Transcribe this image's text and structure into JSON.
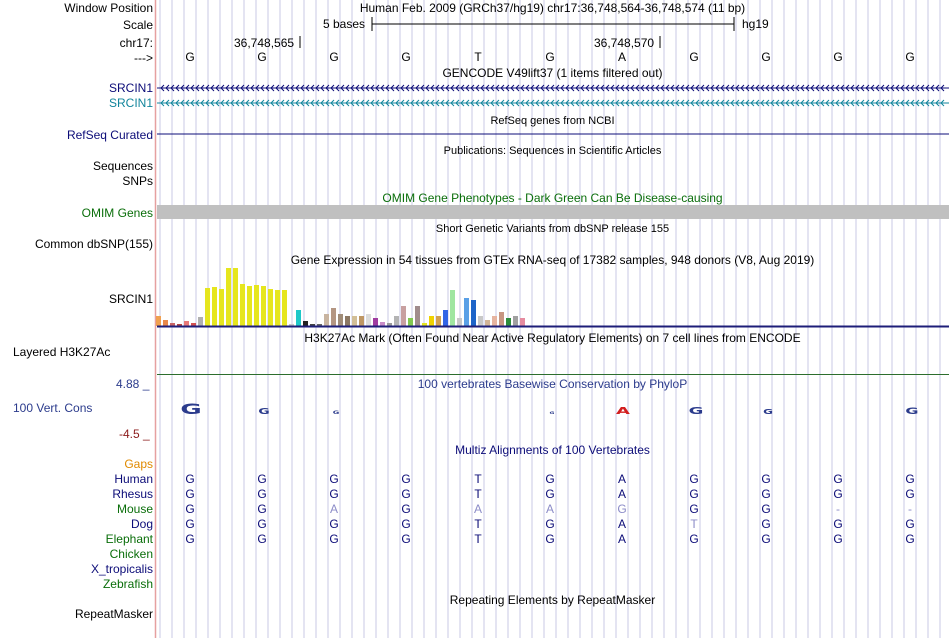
{
  "header": {
    "window_position_label": "Window Position",
    "position_text": "Human Feb. 2009 (GRCh37/hg19)   chr17:36,748,564-36,748,574 (11 bp)",
    "scale_label": "Scale",
    "scale_text": "5 bases",
    "assembly": "hg19",
    "chrom_label": "chr17:",
    "coord_1": "36,748,565",
    "coord_2": "36,748,570",
    "strand_label": "--->",
    "bases": [
      "G",
      "G",
      "G",
      "G",
      "T",
      "G",
      "A",
      "G",
      "G",
      "G",
      "G"
    ]
  },
  "tracks": {
    "gencode": {
      "title": "GENCODE V49lift37 (1 items filtered out)",
      "items": [
        {
          "label": "SRCIN1",
          "color": "#0c0c78"
        },
        {
          "label": "SRCIN1",
          "color": "#12859c"
        }
      ]
    },
    "refseq": {
      "title": "RefSeq genes from NCBI",
      "label": "RefSeq Curated",
      "color": "#0c0c78"
    },
    "publications": {
      "title": "Publications: Sequences in Scientific Articles",
      "label_1": "Sequences",
      "label_2": "SNPs"
    },
    "omim": {
      "title": "OMIM Gene Phenotypes - Dark Green Can Be Disease-causing",
      "label": "OMIM Genes",
      "color": "#0a6e0a",
      "bar_color": "#c0c0c0"
    },
    "dbsnp": {
      "title": "Short Genetic Variants from dbSNP release 155",
      "label": "Common dbSNP(155)"
    },
    "gtex": {
      "title": "Gene Expression in 54 tissues from GTEx RNA-seq of 17382 samples, 948 donors (V8, Aug 2019)",
      "label": "SRCIN1"
    },
    "h3k27ac": {
      "title": "H3K27Ac Mark (Often Found Near Active Regulatory Elements) on 7 cell lines from ENCODE",
      "label": "Layered H3K27Ac"
    },
    "phylop": {
      "title": "100 vertebrates Basewise Conservation by PhyloP",
      "label": "100 Vert. Cons",
      "max": "4.88 _",
      "min": "-4.5 _",
      "color": "#2b3b8c",
      "neg_color": "#8b1a1a"
    },
    "multiz": {
      "title": "Multiz Alignments of 100 Vertebrates",
      "gaps_label": "Gaps",
      "species": [
        {
          "name": "Human",
          "bases": [
            "G",
            "G",
            "G",
            "G",
            "T",
            "G",
            "A",
            "G",
            "G",
            "G",
            "G"
          ]
        },
        {
          "name": "Rhesus",
          "bases": [
            "G",
            "G",
            "G",
            "G",
            "T",
            "G",
            "A",
            "G",
            "G",
            "G",
            "G"
          ]
        },
        {
          "name": "Mouse",
          "bases": [
            "G",
            "G",
            "A",
            "G",
            "A",
            "A",
            "G",
            "G",
            "G",
            "-",
            "-"
          ]
        },
        {
          "name": "Dog",
          "bases": [
            "G",
            "G",
            "G",
            "G",
            "T",
            "G",
            "A",
            "T",
            "G",
            "G",
            "G"
          ]
        },
        {
          "name": "Elephant",
          "bases": [
            "G",
            "G",
            "G",
            "G",
            "T",
            "G",
            "A",
            "G",
            "G",
            "G",
            "G"
          ]
        },
        {
          "name": "Chicken",
          "bases": []
        },
        {
          "name": "X_tropicalis",
          "bases": []
        },
        {
          "name": "Zebrafish",
          "bases": []
        }
      ]
    },
    "repeatmasker": {
      "title": "Repeating Elements by RepeatMasker",
      "label": "RepeatMasker"
    }
  },
  "colors": {
    "label_navy": "#0c0c78",
    "label_teal": "#12859c",
    "label_green": "#0a6e0a",
    "gaps_orange": "#e08a00",
    "grid": "#c8c8e6",
    "left_bar": "#e6a0a0"
  }
}
